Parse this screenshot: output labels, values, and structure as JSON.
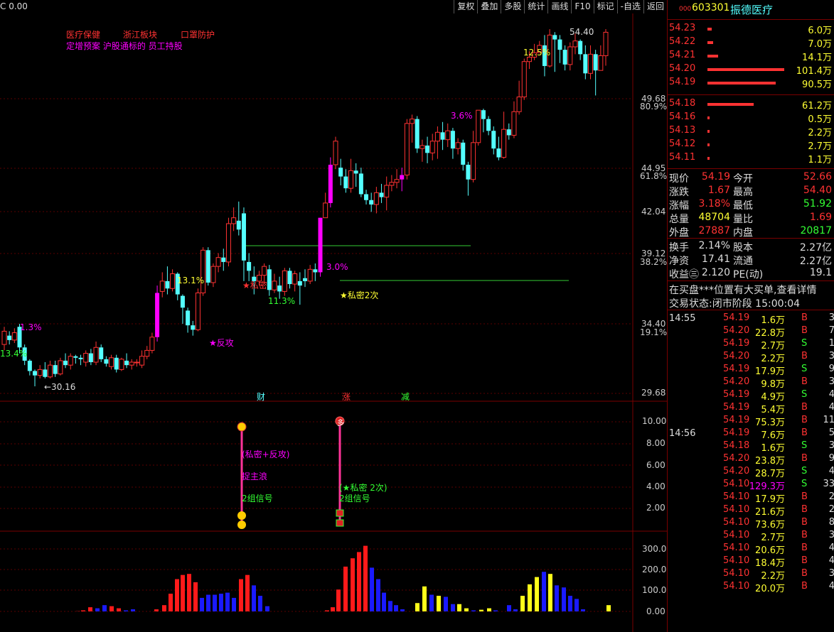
{
  "toolbar": {
    "left_text": "C 0.00",
    "buttons": [
      "复权",
      "叠加",
      "多股",
      "统计",
      "画线",
      "F10",
      "标记",
      "-自选",
      "返回"
    ]
  },
  "annotations": {
    "tags_red": [
      "医疗保健",
      "浙江板块",
      "口罩防护"
    ],
    "tags_magenta": "定增预案 沪股通标的 员工持股"
  },
  "price_axis": [
    {
      "label": "49.68",
      "sub": "80.9%"
    },
    {
      "label": "44.95",
      "sub": "61.8%"
    },
    {
      "label": "42.04",
      "sub": ""
    },
    {
      "label": "39.12",
      "sub": "38.2%"
    },
    {
      "label": "34.40",
      "sub": "19.1%"
    },
    {
      "label": "29.68",
      "sub": ""
    }
  ],
  "chart_labels": {
    "high": "54.40",
    "low": "←30.16",
    "p13_4": "13.4%",
    "p1_3": "1.3%",
    "p13_1": "13.1%",
    "p11_3": "11.3%",
    "p3_0": "3.0%",
    "p3_6": "3.6%",
    "p12_5": "12.5%",
    "fangong": "★反攻",
    "simi": "★私密",
    "simi2": "★私密2次",
    "cai": "财",
    "zhang": "涨",
    "jian": "减"
  },
  "signal": {
    "axis": [
      "10.00",
      "8.00",
      "6.00",
      "4.00",
      "2.00"
    ],
    "txt1": "(私密+反攻)",
    "txt2": "捉主浪",
    "txt3": "2组信号",
    "txt4": "(★私密 2次)",
    "txt5": "2组信号",
    "duo": "多"
  },
  "volume": {
    "axis": [
      "300.0",
      "200.0",
      "100.0",
      "0.00"
    ]
  },
  "stock": {
    "code": "603301",
    "name": "振德医疗",
    "prefix": "000"
  },
  "sell_orders": [
    {
      "price": "54.23",
      "vol": "6.0万",
      "bar": 0.06
    },
    {
      "price": "54.22",
      "vol": "7.0万",
      "bar": 0.07
    },
    {
      "price": "54.21",
      "vol": "14.1万",
      "bar": 0.14
    },
    {
      "price": "54.20",
      "vol": "101.4万",
      "bar": 1.0
    },
    {
      "price": "54.19",
      "vol": "90.5万",
      "bar": 0.89
    }
  ],
  "buy_orders": [
    {
      "price": "54.18",
      "vol": "61.2万",
      "bar": 0.6
    },
    {
      "price": "54.16",
      "vol": "0.5万",
      "bar": 0.01
    },
    {
      "price": "54.13",
      "vol": "2.2万",
      "bar": 0.02
    },
    {
      "price": "54.12",
      "vol": "2.7万",
      "bar": 0.03
    },
    {
      "price": "54.11",
      "vol": "1.1万",
      "bar": 0.01
    }
  ],
  "info": [
    {
      "l1": "现价",
      "v1": "54.19",
      "l2": "今开",
      "v2": "52.66"
    },
    {
      "l1": "涨跌",
      "v1": "1.67",
      "l2": "最高",
      "v2": "54.40"
    },
    {
      "l1": "涨幅",
      "v1": "3.18%",
      "l2": "最低",
      "v2": "51.92"
    },
    {
      "l1": "总量",
      "v1": "48704",
      "l2": "量比",
      "v2": "1.69"
    },
    {
      "l1": "外盘",
      "v1": "27887",
      "l2": "内盘",
      "v2": "20817"
    }
  ],
  "info2": [
    {
      "l1": "换手",
      "v1": "2.14%",
      "l2": "股本",
      "v2": "2.27亿"
    },
    {
      "l1": "净资",
      "v1": "17.41",
      "l2": "流通",
      "v2": "2.27亿"
    },
    {
      "l1": "收益㊂",
      "v1": "2.120",
      "l2": "PE(动)",
      "v2": "19.1"
    }
  ],
  "notice": "在买盘***位置有大买单,查看详情",
  "trade_status": "交易状态:闭市阶段 15:00:04",
  "trades1_time": "14:55",
  "trades1": [
    {
      "p": "54.19",
      "v": "1.6万",
      "s": "B",
      "n": "3"
    },
    {
      "p": "54.20",
      "v": "22.8万",
      "s": "B",
      "n": "7"
    },
    {
      "p": "54.19",
      "v": "2.7万",
      "s": "S",
      "n": "1"
    },
    {
      "p": "54.20",
      "v": "2.2万",
      "s": "B",
      "n": "3"
    },
    {
      "p": "54.19",
      "v": "17.9万",
      "s": "S",
      "n": "9"
    },
    {
      "p": "54.20",
      "v": "9.8万",
      "s": "B",
      "n": "3"
    },
    {
      "p": "54.19",
      "v": "4.9万",
      "s": "S",
      "n": "4"
    },
    {
      "p": "54.19",
      "v": "5.4万",
      "s": "B",
      "n": "4"
    },
    {
      "p": "54.19",
      "v": "75.3万",
      "s": "B",
      "n": "11"
    }
  ],
  "trades2_time": "14:56",
  "trades2": [
    {
      "p": "54.19",
      "v": "7.6万",
      "s": "B",
      "n": "5"
    },
    {
      "p": "54.18",
      "v": "1.6万",
      "s": "S",
      "n": "3"
    },
    {
      "p": "54.20",
      "v": "23.8万",
      "s": "B",
      "n": "9"
    },
    {
      "p": "54.20",
      "v": "28.7万",
      "s": "S",
      "n": "4"
    },
    {
      "p": "54.10",
      "v": "129.3万",
      "s": "S",
      "n": "33"
    },
    {
      "p": "54.10",
      "v": "17.9万",
      "s": "B",
      "n": "2"
    },
    {
      "p": "54.10",
      "v": "21.6万",
      "s": "B",
      "n": "2"
    },
    {
      "p": "54.10",
      "v": "73.6万",
      "s": "B",
      "n": "8"
    },
    {
      "p": "54.10",
      "v": "2.7万",
      "s": "B",
      "n": "3"
    },
    {
      "p": "54.10",
      "v": "20.6万",
      "s": "B",
      "n": "4"
    },
    {
      "p": "54.10",
      "v": "18.4万",
      "s": "B",
      "n": "4"
    },
    {
      "p": "54.10",
      "v": "2.2万",
      "s": "B",
      "n": "3"
    },
    {
      "p": "54.10",
      "v": "20.0万",
      "s": "B",
      "n": "4"
    }
  ],
  "colors": {
    "up": "#ff3232",
    "down": "#54ffff",
    "magenta": "#ff00ff",
    "yellow": "#ffff33",
    "green": "#33ff33"
  }
}
